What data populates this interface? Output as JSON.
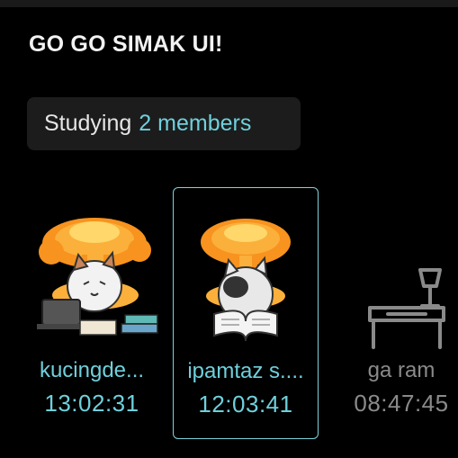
{
  "group": {
    "title": "GO GO SIMAK UI!"
  },
  "status": {
    "label": "Studying",
    "count": "2 members"
  },
  "members": [
    {
      "name": "kucingde...",
      "time": "13:02:31",
      "avatar": "cat-explosion-laptop-books",
      "state": "studying"
    },
    {
      "name": "ipamtaz s....",
      "time": "12:03:41",
      "avatar": "cat-explosion-reading",
      "state": "studying",
      "selected": true
    },
    {
      "name": "ga ram",
      "time": "08:47:45",
      "avatar": "empty-desk-lamp-icon",
      "state": "away"
    }
  ],
  "colors": {
    "accent": "#6fd0dc",
    "inactive": "#8a8a8a",
    "background": "#000000",
    "pill": "#1c1c1c"
  }
}
